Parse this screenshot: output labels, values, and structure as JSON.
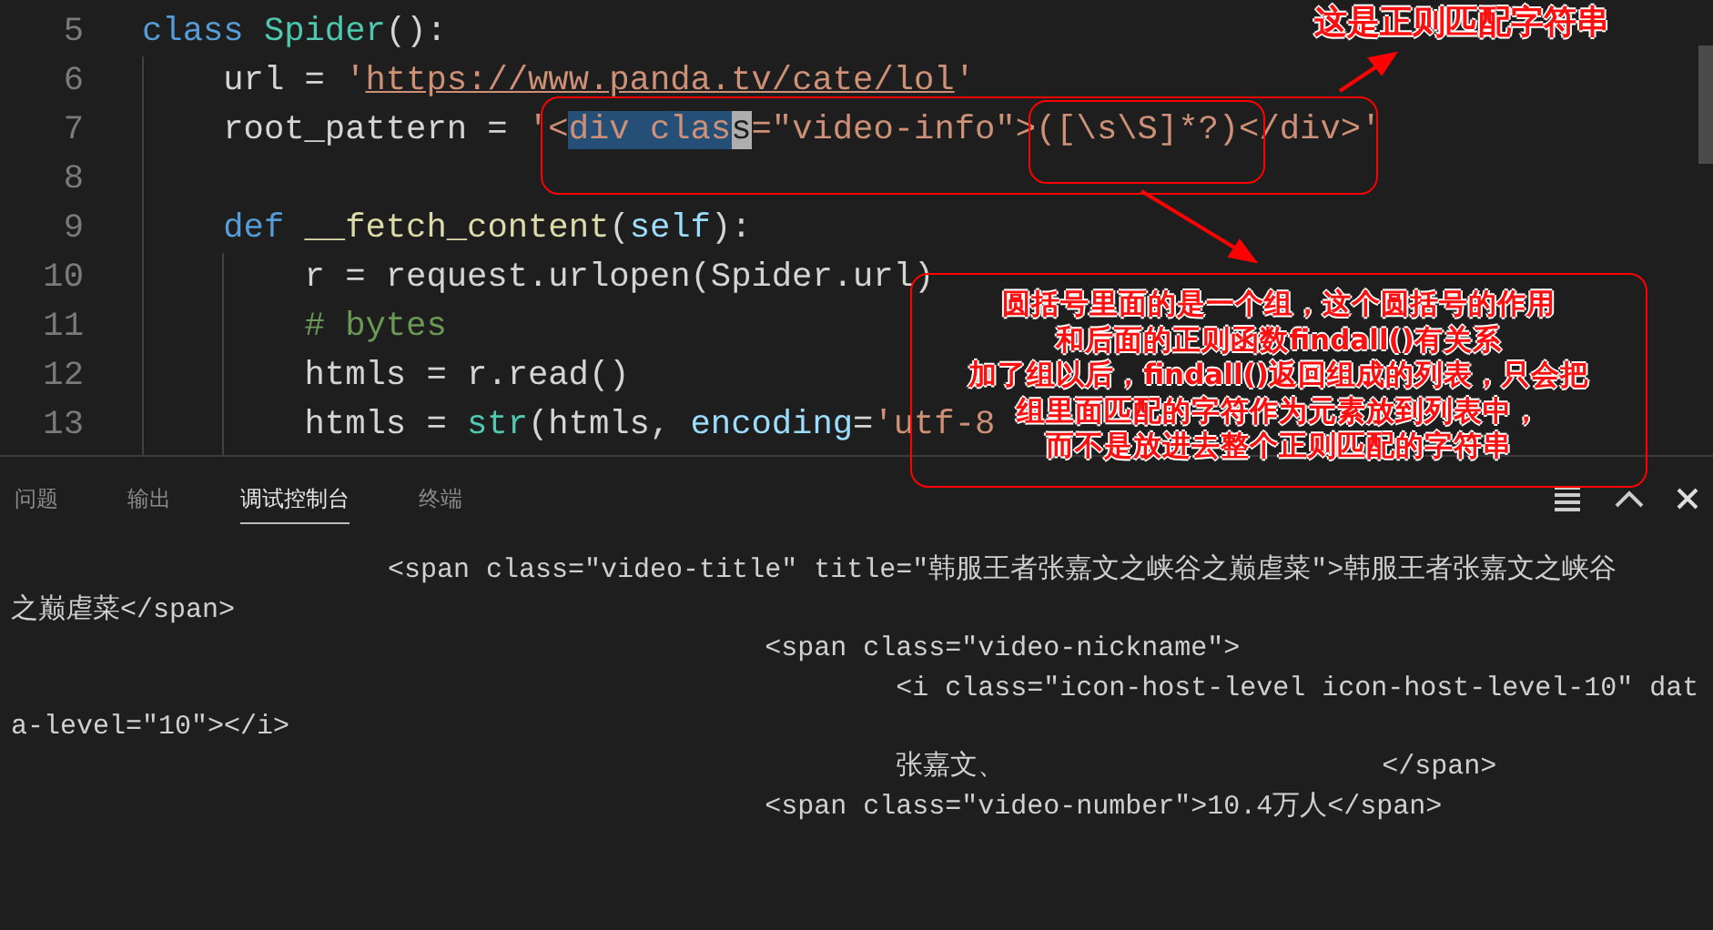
{
  "editor": {
    "lines": [
      {
        "number": "5",
        "tokens": [
          {
            "text": "class",
            "kind": "keyword"
          },
          {
            "text": " Spider",
            "kind": "classname"
          },
          {
            "text": "():",
            "kind": "plain"
          }
        ]
      },
      {
        "number": "6",
        "tokens": [
          {
            "text": "    url = ",
            "kind": "plain"
          },
          {
            "text": "'",
            "kind": "string"
          },
          {
            "text": "https://www.panda.tv/cate/lol",
            "kind": "url"
          },
          {
            "text": "'",
            "kind": "string"
          }
        ]
      },
      {
        "number": "7",
        "tokens": [
          {
            "text": "    root_pattern = ",
            "kind": "plain"
          },
          {
            "text": "'<",
            "kind": "string"
          },
          {
            "text": "div clas",
            "kind": "selection"
          },
          {
            "text": "s",
            "kind": "cursor"
          },
          {
            "text": "=\"video-info\">([\\s\\S]*?)</div>'",
            "kind": "string"
          }
        ]
      },
      {
        "number": "8"
      },
      {
        "number": "9",
        "tokens": [
          {
            "text": "    def",
            "kind": "keyword"
          },
          {
            "text": " __fetch_content",
            "kind": "function"
          },
          {
            "text": "(",
            "kind": "plain"
          },
          {
            "text": "self",
            "kind": "param"
          },
          {
            "text": "):",
            "kind": "plain"
          }
        ]
      },
      {
        "number": "10",
        "tokens": [
          {
            "text": "        r = request.urlopen(Spider.url)",
            "kind": "plain"
          }
        ]
      },
      {
        "number": "11",
        "tokens": [
          {
            "text": "        # bytes",
            "kind": "comment"
          }
        ]
      },
      {
        "number": "12",
        "tokens": [
          {
            "text": "        htmls = r.read()",
            "kind": "plain"
          }
        ]
      },
      {
        "number": "13",
        "tokens": [
          {
            "text": "        htmls = ",
            "kind": "plain"
          },
          {
            "text": "str",
            "kind": "builtin"
          },
          {
            "text": "(htmls, ",
            "kind": "plain"
          },
          {
            "text": "encoding",
            "kind": "param"
          },
          {
            "text": "=",
            "kind": "plain"
          },
          {
            "text": "'utf-8",
            "kind": "string"
          }
        ]
      }
    ]
  },
  "panel": {
    "tabs": [
      {
        "label": "问题",
        "selected": false
      },
      {
        "label": "输出",
        "selected": false
      },
      {
        "label": "调试控制台",
        "selected": true
      },
      {
        "label": "终端",
        "selected": false
      }
    ],
    "console_lines": [
      "                       <span class=\"video-title\" title=\"韩服王者张嘉文之峡谷之巅虐菜\">韩服王者张嘉文之峡谷",
      "之巅虐菜</span>",
      "                                              <span class=\"video-nickname\">",
      "                                                      <i class=\"icon-host-level icon-host-level-10\" dat",
      "a-level=\"10\"></i>",
      "                                                      张嘉文、                       </span>",
      "                                              <span class=\"video-number\">10.4万人</span>"
    ]
  },
  "annotations": {
    "top_label": "这是正则匹配字符串",
    "note_lines": [
      "圆括号里面的是一个组，这个圆括号的作用",
      "和后面的正则函数findall()有关系",
      "加了组以后，findall()返回组成的列表，只会把",
      "组里面匹配的字符作为元素放到列表中，",
      "而不是放进去整个正则匹配的字符串"
    ]
  }
}
